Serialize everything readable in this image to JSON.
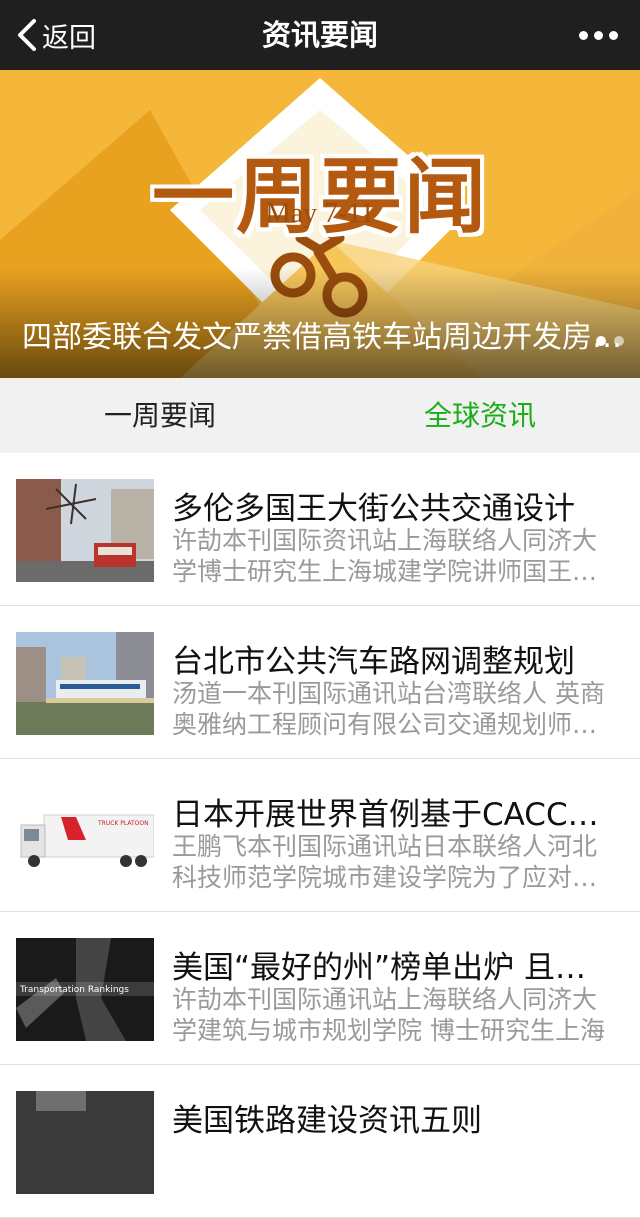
{
  "nav": {
    "back_label": "返回",
    "title": "资讯要闻",
    "more_icon": "more-dots-icon"
  },
  "banner": {
    "headline": "一周要闻",
    "date": "May  7-11",
    "caption": "四部委联合发文严禁借高铁车站周边开发房地产",
    "colors": {
      "bg": "#f4b73a",
      "headline": "#b45a10"
    }
  },
  "tabs": [
    {
      "label": "一周要闻",
      "active": false
    },
    {
      "label": "全球资讯",
      "active": true
    }
  ],
  "articles": [
    {
      "title": "多伦多国王大街公共交通设计",
      "desc": "许劼本刊国际资讯站上海联络人同济大学博士研究生上海城建学院讲师国王大街",
      "thumb": "street-tram-image"
    },
    {
      "title": "台北市公共汽车路网调整规划",
      "desc": "汤道一本刊国际通讯站台湾联络人 英商奥雅纳工程顾问有限公司交通规划师台北",
      "thumb": "monorail-city-image"
    },
    {
      "title": "日本开展世界首例基于CACC的卡车编队实验",
      "desc": "王鹏飞本刊国际通讯站日本联络人河北科技师范学院城市建设学院为了应对物流",
      "thumb": "truck-platoon-image",
      "thumb_text": "TRUCK PLATOON"
    },
    {
      "title": "美国“最好的州”榜单出炉 且看交通排名",
      "desc": "许劼本刊国际通讯站上海联络人同济大学建筑与城市规划学院 博士研究生上海",
      "thumb": "transportation-rankings-image",
      "thumb_text": "Transportation Rankings"
    },
    {
      "title": "美国铁路建设资讯五则",
      "desc": "",
      "thumb": "railway-image"
    }
  ],
  "colors": {
    "nav_bg": "#1f1f1f",
    "tab_active": "#1aad19",
    "tabs_bg": "#f1f1f1"
  }
}
